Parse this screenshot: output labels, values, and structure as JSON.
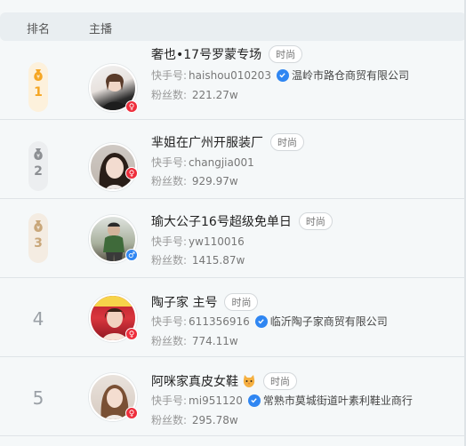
{
  "header": {
    "rank_label": "排名",
    "anchor_label": "主播"
  },
  "labels": {
    "kuaishou": "快手号:",
    "fans": "粉丝数:"
  },
  "rows": [
    {
      "rank": "1",
      "name": "奢也•17号罗蒙专场",
      "tag": "时尚",
      "id": "haishou010203",
      "verified": true,
      "company": "温岭市路仓商贸有限公司",
      "fans": "221.27w",
      "gender": "female"
    },
    {
      "rank": "2",
      "name": "芈姐在广州开服装厂",
      "tag": "时尚",
      "id": "changjia001",
      "verified": false,
      "company": "",
      "fans": "929.97w",
      "gender": "female"
    },
    {
      "rank": "3",
      "name": "瑜大公子16号超级免单日",
      "tag": "时尚",
      "id": "yw110016",
      "verified": false,
      "company": "",
      "fans": "1415.87w",
      "gender": "male"
    },
    {
      "rank": "4",
      "name": "陶子家 主号",
      "tag": "时尚",
      "id": "611356916",
      "verified": true,
      "company": "临沂陶子家商贸有限公司",
      "fans": "774.11w",
      "gender": "female"
    },
    {
      "rank": "5",
      "name": "阿咪家真皮女鞋",
      "tag": "时尚",
      "id": "mi951120",
      "verified": true,
      "company": "常熟市莫城街道叶素利鞋业商行",
      "fans": "295.78w",
      "gender": "female",
      "emoji": "cat-face-icon"
    }
  ],
  "colors": {
    "gold": "#f5a623",
    "silver": "#8c8f93",
    "bronze": "#c9a77a",
    "female": "#ee2d3b",
    "male": "#2f86f2",
    "verify": "#2f86f2"
  }
}
